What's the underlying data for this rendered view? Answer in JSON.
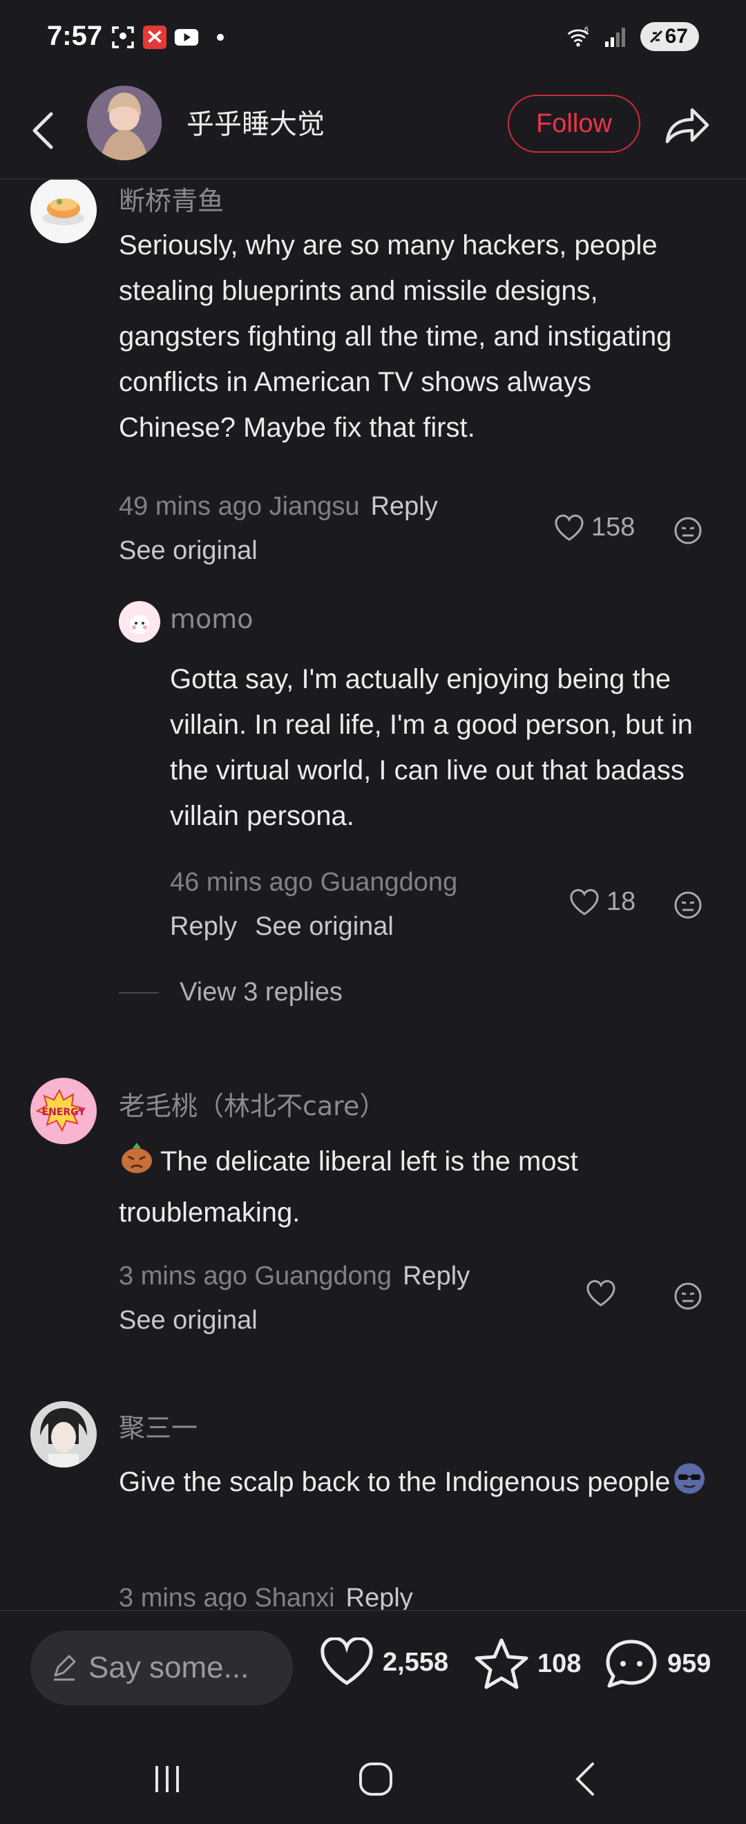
{
  "status_bar": {
    "time": "7:57",
    "battery": "67",
    "network": "6"
  },
  "header": {
    "channel_name": "乎乎睡大觉",
    "follow_label": "Follow"
  },
  "comments": [
    {
      "username": "断桥青鱼",
      "text": "Seriously, why are so many hackers, people stealing blueprints and missile designs, gangsters fighting all the time, and instigating conflicts in American TV shows always Chinese? Maybe fix that first.",
      "time_location": "49 mins ago Jiangsu",
      "reply_label": "Reply",
      "see_original": "See original",
      "likes": "158"
    },
    {
      "username": "momo",
      "text": "Gotta say, I'm actually enjoying being the villain. In real life, I'm a good person, but in the virtual world, I can live out that badass villain persona.",
      "time_location": "46 mins ago Guangdong",
      "reply_label": "Reply",
      "see_original": "See original",
      "likes": "18",
      "view_replies": "View 3 replies"
    },
    {
      "username": "老毛桃（林北不care）",
      "text": "The delicate liberal left is the most troublemaking.",
      "time_location": "3 mins ago Guangdong",
      "reply_label": "Reply",
      "see_original": "See original",
      "likes": ""
    },
    {
      "username": "聚三一",
      "text": "Give the scalp back to the Indigenous people",
      "time_location": "3 mins ago Shanxi",
      "reply_label": "Reply"
    }
  ],
  "bottom_bar": {
    "input_placeholder": "Say some...",
    "likes_count": "2,558",
    "favorites_count": "108",
    "comments_count": "959"
  },
  "colors": {
    "background": "#1b1b1f",
    "accent": "#ef3447",
    "text": "#ececec",
    "muted": "#808086"
  }
}
